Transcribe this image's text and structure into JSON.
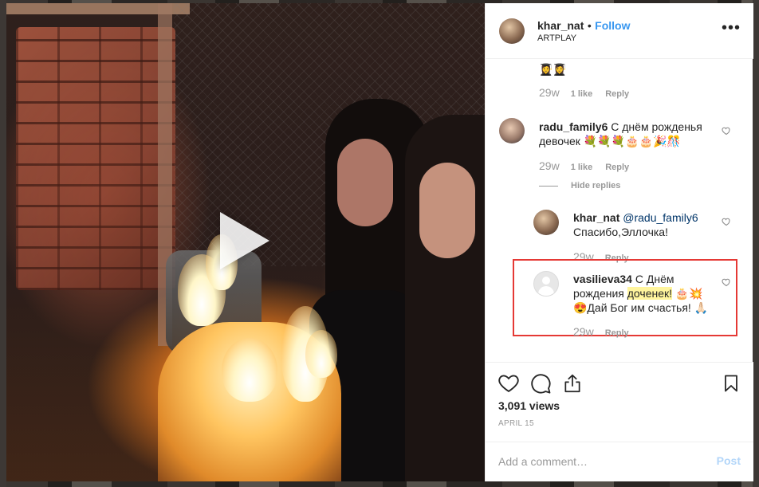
{
  "post": {
    "author": "khar_nat",
    "separator": "•",
    "follow_label": "Follow",
    "location": "ARTPLAY",
    "more_icon": "more-options-icon",
    "views": "3,091 views",
    "date": "APRIL 15"
  },
  "comments": [
    {
      "emoji": "👩‍🎓👩‍🎓",
      "age": "29w",
      "likes": "1 like",
      "reply_label": "Reply"
    },
    {
      "username": "radu_family6",
      "text": "С днём рожденья девочек 💐💐💐🎂🎂🎉🎊",
      "age": "29w",
      "likes": "1 like",
      "reply_label": "Reply",
      "hide_replies_label": "Hide replies"
    }
  ],
  "replies": [
    {
      "username": "khar_nat",
      "mention": "@radu_family6",
      "text": "Спасибо,Эллочка!",
      "age": "29w",
      "reply_label": "Reply"
    },
    {
      "username": "vasilieva34",
      "text_before": "С Днём рождения ",
      "text_highlight": "доченек!",
      "text_after": " 🎂💥😍Дай Бог им счастья! 🙏🏻",
      "age": "29w",
      "reply_label": "Reply"
    }
  ],
  "actions": {
    "like_icon": "heart-icon",
    "comment_icon": "comment-bubble-icon",
    "share_icon": "share-icon",
    "save_icon": "bookmark-icon"
  },
  "composer": {
    "placeholder": "Add a comment…",
    "post_label": "Post"
  },
  "colors": {
    "link_blue": "#3897f0",
    "muted": "#999999",
    "text": "#262626",
    "highlight_border": "#e53935",
    "highlight_fill": "#fff59d"
  }
}
